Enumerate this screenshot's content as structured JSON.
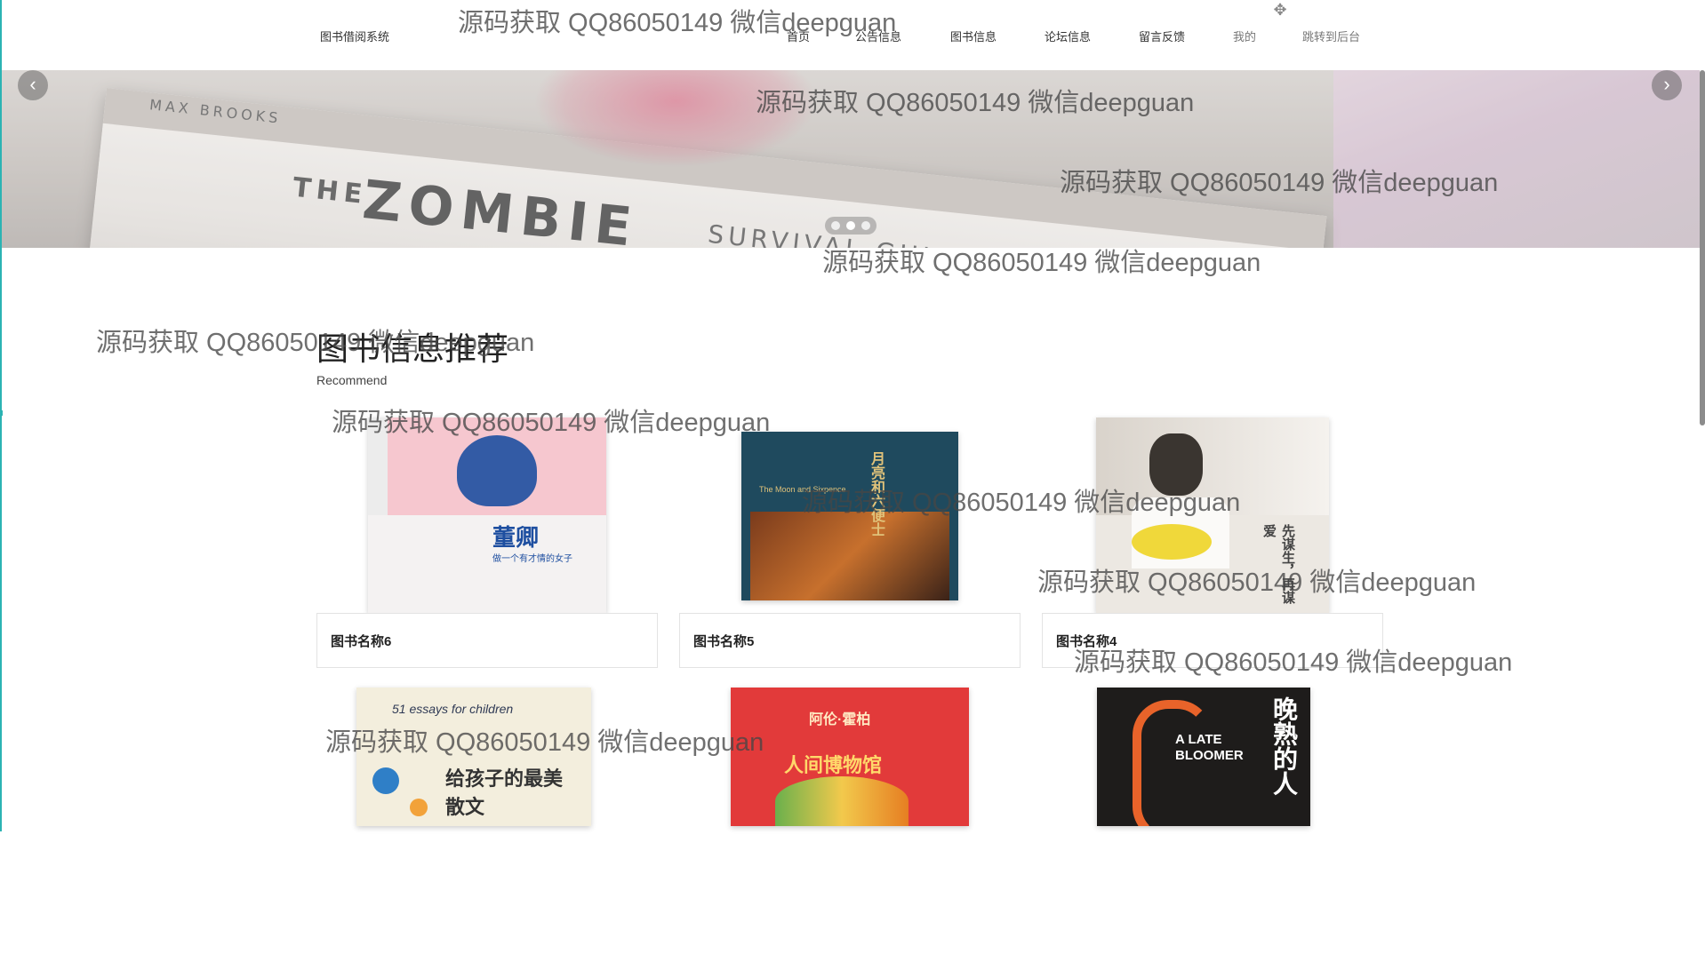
{
  "header": {
    "brand": "图书借阅系统",
    "nav": [
      "首页",
      "公告信息",
      "图书信息",
      "论坛信息",
      "留言反馈",
      "我的",
      "跳转到后台"
    ]
  },
  "banner": {
    "author": "MAX BROOKS",
    "title_small": "THE",
    "title_big": "ZOMBIE",
    "title_sub": "SURVIVAL GUIDE",
    "slides": 3,
    "active_slide": 2
  },
  "section": {
    "title": "图书信息推荐",
    "subtitle": "Recommend"
  },
  "books": [
    {
      "name": "图书名称6",
      "cover_title": "董卿",
      "cover_sub": "做一个有才情的女子",
      "cover_color": "#f6c7cf",
      "accent": "#1e4fa0"
    },
    {
      "name": "图书名称5",
      "cover_title": "月亮和六便士",
      "cover_sub": "The Moon and Sixpence",
      "cover_color": "#1f4a5e",
      "accent": "#e0c27a"
    },
    {
      "name": "图书名称4",
      "cover_title": "先谋生，再谋爱",
      "cover_sub": "",
      "cover_color": "#ece8e2",
      "accent": "#f0d83a"
    },
    {
      "name": "",
      "cover_title": "给孩子的最美散文",
      "cover_sub": "51 essays for children",
      "cover_color": "#f3eedd",
      "accent": "#2f7fc7"
    },
    {
      "name": "",
      "cover_title": "人间博物馆",
      "cover_sub": "阿伦·霍柏",
      "cover_color": "#e23a3a",
      "accent": "#ffd86a"
    },
    {
      "name": "",
      "cover_title": "晚熟的人",
      "cover_sub": "A LATE BLOOMER",
      "cover_color": "#1e1c1b",
      "accent": "#e8632a"
    }
  ],
  "watermark": "源码获取 QQ86050149 微信deepguan",
  "icons": {
    "move": "move-icon",
    "prev": "chevron-left-icon",
    "next": "chevron-right-icon"
  }
}
